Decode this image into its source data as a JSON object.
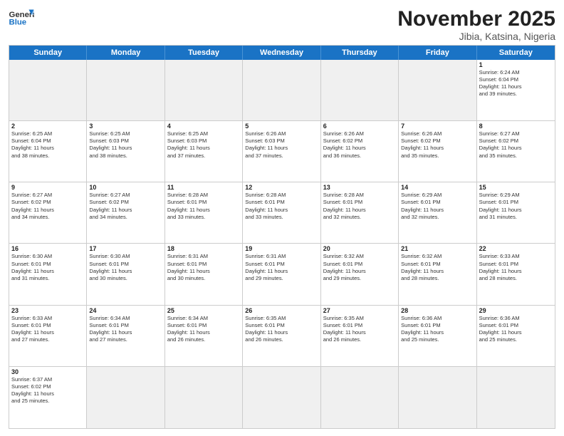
{
  "logo": {
    "general": "General",
    "blue": "Blue"
  },
  "title": "November 2025",
  "subtitle": "Jibia, Katsina, Nigeria",
  "header_days": [
    "Sunday",
    "Monday",
    "Tuesday",
    "Wednesday",
    "Thursday",
    "Friday",
    "Saturday"
  ],
  "weeks": [
    [
      {
        "day": "",
        "info": "",
        "shaded": true
      },
      {
        "day": "",
        "info": "",
        "shaded": true
      },
      {
        "day": "",
        "info": "",
        "shaded": true
      },
      {
        "day": "",
        "info": "",
        "shaded": true
      },
      {
        "day": "",
        "info": "",
        "shaded": true
      },
      {
        "day": "",
        "info": "",
        "shaded": true
      },
      {
        "day": "1",
        "info": "Sunrise: 6:24 AM\nSunset: 6:04 PM\nDaylight: 11 hours\nand 39 minutes."
      }
    ],
    [
      {
        "day": "2",
        "info": "Sunrise: 6:25 AM\nSunset: 6:04 PM\nDaylight: 11 hours\nand 38 minutes."
      },
      {
        "day": "3",
        "info": "Sunrise: 6:25 AM\nSunset: 6:03 PM\nDaylight: 11 hours\nand 38 minutes."
      },
      {
        "day": "4",
        "info": "Sunrise: 6:25 AM\nSunset: 6:03 PM\nDaylight: 11 hours\nand 37 minutes."
      },
      {
        "day": "5",
        "info": "Sunrise: 6:26 AM\nSunset: 6:03 PM\nDaylight: 11 hours\nand 37 minutes."
      },
      {
        "day": "6",
        "info": "Sunrise: 6:26 AM\nSunset: 6:02 PM\nDaylight: 11 hours\nand 36 minutes."
      },
      {
        "day": "7",
        "info": "Sunrise: 6:26 AM\nSunset: 6:02 PM\nDaylight: 11 hours\nand 35 minutes."
      },
      {
        "day": "8",
        "info": "Sunrise: 6:27 AM\nSunset: 6:02 PM\nDaylight: 11 hours\nand 35 minutes."
      }
    ],
    [
      {
        "day": "9",
        "info": "Sunrise: 6:27 AM\nSunset: 6:02 PM\nDaylight: 11 hours\nand 34 minutes."
      },
      {
        "day": "10",
        "info": "Sunrise: 6:27 AM\nSunset: 6:02 PM\nDaylight: 11 hours\nand 34 minutes."
      },
      {
        "day": "11",
        "info": "Sunrise: 6:28 AM\nSunset: 6:01 PM\nDaylight: 11 hours\nand 33 minutes."
      },
      {
        "day": "12",
        "info": "Sunrise: 6:28 AM\nSunset: 6:01 PM\nDaylight: 11 hours\nand 33 minutes."
      },
      {
        "day": "13",
        "info": "Sunrise: 6:28 AM\nSunset: 6:01 PM\nDaylight: 11 hours\nand 32 minutes."
      },
      {
        "day": "14",
        "info": "Sunrise: 6:29 AM\nSunset: 6:01 PM\nDaylight: 11 hours\nand 32 minutes."
      },
      {
        "day": "15",
        "info": "Sunrise: 6:29 AM\nSunset: 6:01 PM\nDaylight: 11 hours\nand 31 minutes."
      }
    ],
    [
      {
        "day": "16",
        "info": "Sunrise: 6:30 AM\nSunset: 6:01 PM\nDaylight: 11 hours\nand 31 minutes."
      },
      {
        "day": "17",
        "info": "Sunrise: 6:30 AM\nSunset: 6:01 PM\nDaylight: 11 hours\nand 30 minutes."
      },
      {
        "day": "18",
        "info": "Sunrise: 6:31 AM\nSunset: 6:01 PM\nDaylight: 11 hours\nand 30 minutes."
      },
      {
        "day": "19",
        "info": "Sunrise: 6:31 AM\nSunset: 6:01 PM\nDaylight: 11 hours\nand 29 minutes."
      },
      {
        "day": "20",
        "info": "Sunrise: 6:32 AM\nSunset: 6:01 PM\nDaylight: 11 hours\nand 29 minutes."
      },
      {
        "day": "21",
        "info": "Sunrise: 6:32 AM\nSunset: 6:01 PM\nDaylight: 11 hours\nand 28 minutes."
      },
      {
        "day": "22",
        "info": "Sunrise: 6:33 AM\nSunset: 6:01 PM\nDaylight: 11 hours\nand 28 minutes."
      }
    ],
    [
      {
        "day": "23",
        "info": "Sunrise: 6:33 AM\nSunset: 6:01 PM\nDaylight: 11 hours\nand 27 minutes."
      },
      {
        "day": "24",
        "info": "Sunrise: 6:34 AM\nSunset: 6:01 PM\nDaylight: 11 hours\nand 27 minutes."
      },
      {
        "day": "25",
        "info": "Sunrise: 6:34 AM\nSunset: 6:01 PM\nDaylight: 11 hours\nand 26 minutes."
      },
      {
        "day": "26",
        "info": "Sunrise: 6:35 AM\nSunset: 6:01 PM\nDaylight: 11 hours\nand 26 minutes."
      },
      {
        "day": "27",
        "info": "Sunrise: 6:35 AM\nSunset: 6:01 PM\nDaylight: 11 hours\nand 26 minutes."
      },
      {
        "day": "28",
        "info": "Sunrise: 6:36 AM\nSunset: 6:01 PM\nDaylight: 11 hours\nand 25 minutes."
      },
      {
        "day": "29",
        "info": "Sunrise: 6:36 AM\nSunset: 6:01 PM\nDaylight: 11 hours\nand 25 minutes."
      }
    ],
    [
      {
        "day": "30",
        "info": "Sunrise: 6:37 AM\nSunset: 6:02 PM\nDaylight: 11 hours\nand 25 minutes."
      },
      {
        "day": "",
        "info": "",
        "shaded": true
      },
      {
        "day": "",
        "info": "",
        "shaded": true
      },
      {
        "day": "",
        "info": "",
        "shaded": true
      },
      {
        "day": "",
        "info": "",
        "shaded": true
      },
      {
        "day": "",
        "info": "",
        "shaded": true
      },
      {
        "day": "",
        "info": "",
        "shaded": true
      }
    ]
  ]
}
